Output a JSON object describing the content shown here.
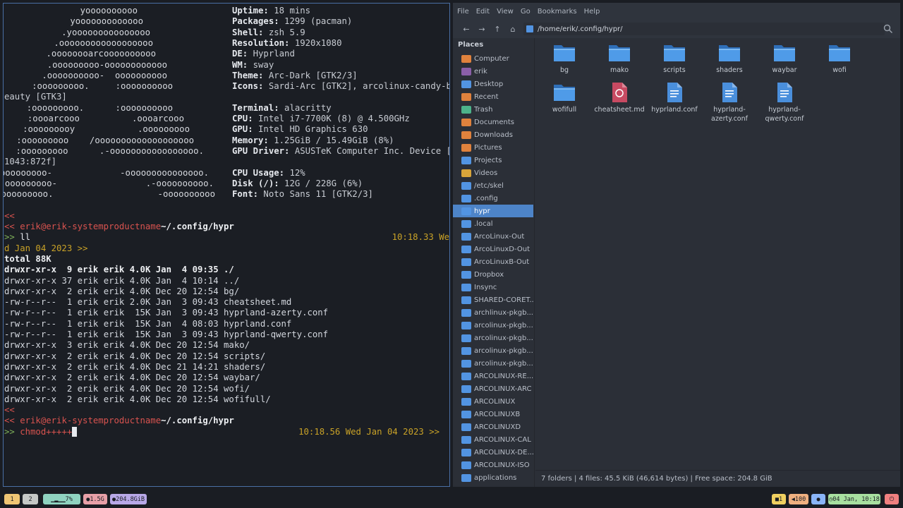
{
  "terminal": {
    "neofetch_art": [
      "yoooooooooo",
      "yooooooooooooo",
      ".yooooooooooooooo",
      ".oooooooooooooooooo",
      ".oooooooarcoooooooooo",
      ".ooooooooo-oooooooooooo",
      ".oooooooooo-  oooooooooo",
      ":ooooooooo.     :oooooooooo",
      ":ooooooooo.      :oooooooooo",
      ":oooarcooo          .oooarcooo",
      ":ooooooooy            .ooooooooo",
      ":ooooooooo    /ooooooooooooooooooo",
      ":ooooooooo      .-ooooooooooooooooo.",
      "ooooooooo-             -ooooooooooooooo.",
      "ooooooooo-                 .-oooooooooo.",
      "ooooooooo.                    -oooooooooo"
    ],
    "sysinfo": [
      {
        "label": "Uptime:",
        "value": " 18 mins"
      },
      {
        "label": "Packages:",
        "value": " 1299 (pacman)"
      },
      {
        "label": "Shell:",
        "value": " zsh 5.9"
      },
      {
        "label": "Resolution:",
        "value": " 1920x1080"
      },
      {
        "label": "DE:",
        "value": " Hyprland"
      },
      {
        "label": "WM:",
        "value": " sway"
      },
      {
        "label": "Theme:",
        "value": " Arc-Dark [GTK2/3]"
      },
      {
        "label": "Icons:",
        "value": " Sardi-Arc [GTK2], arcolinux-candy-b"
      },
      {
        "label": "",
        "value": "eauty [GTK3]"
      },
      {
        "label": "Terminal:",
        "value": " alacritty"
      },
      {
        "label": "CPU:",
        "value": " Intel i7-7700K (8) @ 4.500GHz"
      },
      {
        "label": "GPU:",
        "value": " Intel HD Graphics 630"
      },
      {
        "label": "Memory:",
        "value": " 1.25GiB / 15.49GiB (8%)"
      },
      {
        "label": "GPU Driver:",
        "value": " ASUSTeK Computer Inc. Device ["
      },
      {
        "label": "",
        "value": "1043:872f]"
      },
      {
        "label": "CPU Usage:",
        "value": " 12%"
      },
      {
        "label": "Disk (/):",
        "value": " 12G / 228G (6%)"
      },
      {
        "label": "Font:",
        "value": " Noto Sans 11 [GTK2/3]"
      }
    ],
    "prompt1": {
      "marker": "<<",
      "user_prefix": "<< ",
      "user_host": "erik@erik-systemproductname",
      "path": "~/.config/hypr",
      "prompt_symbol": ">> ",
      "command": "ll",
      "timestamp": "10:18.33 We",
      "timestamp_wrap": "d Jan 04 2023 >>"
    },
    "ls_total": "total 88K",
    "ls_rows": [
      {
        "perm": "drwxr-xr-x",
        "links": " 9",
        "user": "erik",
        "group": "erik",
        "size": "4.0K",
        "date": "Jan  4 09:35",
        "name": "./",
        "bold": true
      },
      {
        "perm": "drwxr-xr-x",
        "links": "37",
        "user": "erik",
        "group": "erik",
        "size": "4.0K",
        "date": "Jan  4 10:14",
        "name": "../",
        "bold": false
      },
      {
        "perm": "drwxr-xr-x",
        "links": " 2",
        "user": "erik",
        "group": "erik",
        "size": "4.0K",
        "date": "Dec 20 12:54",
        "name": "bg/",
        "bold": false
      },
      {
        "perm": "-rw-r--r--",
        "links": " 1",
        "user": "erik",
        "group": "erik",
        "size": "2.0K",
        "date": "Jan  3 09:43",
        "name": "cheatsheet.md",
        "bold": false
      },
      {
        "perm": "-rw-r--r--",
        "links": " 1",
        "user": "erik",
        "group": "erik",
        "size": " 15K",
        "date": "Jan  3 09:43",
        "name": "hyprland-azerty.conf",
        "bold": false
      },
      {
        "perm": "-rw-r--r--",
        "links": " 1",
        "user": "erik",
        "group": "erik",
        "size": " 15K",
        "date": "Jan  4 08:03",
        "name": "hyprland.conf",
        "bold": false
      },
      {
        "perm": "-rw-r--r--",
        "links": " 1",
        "user": "erik",
        "group": "erik",
        "size": " 15K",
        "date": "Jan  3 09:43",
        "name": "hyprland-qwerty.conf",
        "bold": false
      },
      {
        "perm": "drwxr-xr-x",
        "links": " 3",
        "user": "erik",
        "group": "erik",
        "size": "4.0K",
        "date": "Dec 20 12:54",
        "name": "mako/",
        "bold": false
      },
      {
        "perm": "drwxr-xr-x",
        "links": " 2",
        "user": "erik",
        "group": "erik",
        "size": "4.0K",
        "date": "Dec 20 12:54",
        "name": "scripts/",
        "bold": false
      },
      {
        "perm": "drwxr-xr-x",
        "links": " 2",
        "user": "erik",
        "group": "erik",
        "size": "4.0K",
        "date": "Dec 21 14:21",
        "name": "shaders/",
        "bold": false
      },
      {
        "perm": "drwxr-xr-x",
        "links": " 2",
        "user": "erik",
        "group": "erik",
        "size": "4.0K",
        "date": "Dec 20 12:54",
        "name": "waybar/",
        "bold": false
      },
      {
        "perm": "drwxr-xr-x",
        "links": " 2",
        "user": "erik",
        "group": "erik",
        "size": "4.0K",
        "date": "Dec 20 12:54",
        "name": "wofi/",
        "bold": false
      },
      {
        "perm": "drwxr-xr-x",
        "links": " 2",
        "user": "erik",
        "group": "erik",
        "size": "4.0K",
        "date": "Dec 20 12:54",
        "name": "wofifull/",
        "bold": false
      }
    ],
    "prompt2": {
      "marker": "<<",
      "user_prefix": "<< ",
      "user_host": "erik@erik-systemproductname",
      "path": "~/.config/hypr",
      "prompt_symbol": ">> ",
      "command": "chmod+++++",
      "timestamp": "10:18.56 Wed Jan 04 2023 >>"
    }
  },
  "file_manager": {
    "menu": [
      "File",
      "Edit",
      "View",
      "Go",
      "Bookmarks",
      "Help"
    ],
    "path": "/home/erik/.config/hypr/",
    "places_header": "Places",
    "places": [
      {
        "label": "Computer",
        "icon": "computer-icon",
        "color": "#e0823d"
      },
      {
        "label": "erik",
        "icon": "home-icon",
        "color": "#8b5fa8"
      },
      {
        "label": "Desktop",
        "icon": "desktop-icon",
        "color": "#5294e2"
      },
      {
        "label": "Recent",
        "icon": "recent-icon",
        "color": "#e0823d"
      },
      {
        "label": "Trash",
        "icon": "trash-icon",
        "color": "#4db38a"
      },
      {
        "label": "Documents",
        "icon": "documents-icon",
        "color": "#e0823d"
      },
      {
        "label": "Downloads",
        "icon": "downloads-icon",
        "color": "#e0823d"
      },
      {
        "label": "Pictures",
        "icon": "pictures-icon",
        "color": "#e0823d"
      },
      {
        "label": "Projects",
        "icon": "folder-icon",
        "color": "#5294e2"
      },
      {
        "label": "Videos",
        "icon": "videos-icon",
        "color": "#d9a53a"
      },
      {
        "label": "/etc/skel",
        "icon": "folder-icon",
        "color": "#5294e2"
      },
      {
        "label": ".config",
        "icon": "folder-icon",
        "color": "#5294e2"
      },
      {
        "label": "hypr",
        "icon": "folder-icon",
        "color": "#5294e2",
        "selected": true
      },
      {
        "label": ".local",
        "icon": "folder-icon",
        "color": "#5294e2"
      },
      {
        "label": "ArcoLinux-Out",
        "icon": "folder-icon",
        "color": "#5294e2"
      },
      {
        "label": "ArcoLinuxD-Out",
        "icon": "folder-icon",
        "color": "#5294e2"
      },
      {
        "label": "ArcoLinuxB-Out",
        "icon": "folder-icon",
        "color": "#5294e2"
      },
      {
        "label": "Dropbox",
        "icon": "folder-icon",
        "color": "#5294e2"
      },
      {
        "label": "Insync",
        "icon": "folder-icon",
        "color": "#5294e2"
      },
      {
        "label": "SHARED-CORET...",
        "icon": "folder-icon",
        "color": "#5294e2"
      },
      {
        "label": "archlinux-pkgb...",
        "icon": "folder-icon",
        "color": "#5294e2"
      },
      {
        "label": "arcolinux-pkgb...",
        "icon": "folder-icon",
        "color": "#5294e2"
      },
      {
        "label": "arcolinux-pkgb...",
        "icon": "folder-icon",
        "color": "#5294e2"
      },
      {
        "label": "arcolinux-pkgb...",
        "icon": "folder-icon",
        "color": "#5294e2"
      },
      {
        "label": "arcolinux-pkgb...",
        "icon": "folder-icon",
        "color": "#5294e2"
      },
      {
        "label": "ARCOLINUX-RE...",
        "icon": "folder-icon",
        "color": "#5294e2"
      },
      {
        "label": "ARCOLINUX-ARC",
        "icon": "folder-icon",
        "color": "#5294e2"
      },
      {
        "label": "ARCOLINUX",
        "icon": "folder-icon",
        "color": "#5294e2"
      },
      {
        "label": "ARCOLINUXB",
        "icon": "folder-icon",
        "color": "#5294e2"
      },
      {
        "label": "ARCOLINUXD",
        "icon": "folder-icon",
        "color": "#5294e2"
      },
      {
        "label": "ARCOLINUX-CAL",
        "icon": "folder-icon",
        "color": "#5294e2"
      },
      {
        "label": "ARCOLINUX-DE...",
        "icon": "folder-icon",
        "color": "#5294e2"
      },
      {
        "label": "ARCOLINUX-ISO",
        "icon": "folder-icon",
        "color": "#5294e2"
      },
      {
        "label": "applications",
        "icon": "folder-icon",
        "color": "#5294e2"
      }
    ],
    "files": [
      {
        "name": "bg",
        "type": "folder"
      },
      {
        "name": "mako",
        "type": "folder"
      },
      {
        "name": "scripts",
        "type": "folder"
      },
      {
        "name": "shaders",
        "type": "folder"
      },
      {
        "name": "waybar",
        "type": "folder"
      },
      {
        "name": "wofi",
        "type": "folder"
      },
      {
        "name": "wofifull",
        "type": "folder"
      },
      {
        "name": "cheatsheet.md",
        "type": "markdown"
      },
      {
        "name": "hyprland.conf",
        "type": "conf"
      },
      {
        "name": "hyprland-azerty.conf",
        "line1": "hyprland-",
        "line2": "azerty.conf",
        "type": "conf"
      },
      {
        "name": "hyprland-qwerty.conf",
        "line1": "hyprland-",
        "line2": "qwerty.conf",
        "type": "conf"
      }
    ],
    "status": "7 folders  |  4 files: 45.5 KiB (46,614 bytes)  |  Free space: 204.8 GiB"
  },
  "bar": {
    "workspaces": [
      "1",
      "2"
    ],
    "cpu": "7%",
    "mem": "1.5G",
    "disk": "204.8GiB",
    "updates": "1",
    "volume": "100",
    "datetime": "04 Jan, 10:18",
    "colors": {
      "ws_active": "#f0c674",
      "ws_inactive": "#c5c8c6",
      "cpu": "#8fd3c0",
      "mem": "#e8a0a8",
      "disk": "#b8a8e8",
      "updates": "#f0d060",
      "volume": "#f0b080",
      "tray": "#8ab4f8",
      "clock": "#a8e0a0",
      "power": "#f08080"
    }
  }
}
